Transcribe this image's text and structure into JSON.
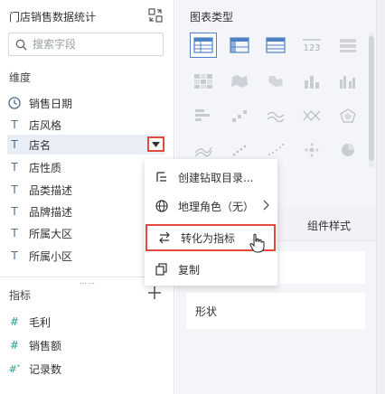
{
  "left": {
    "title": "门店销售数据统计",
    "search_placeholder": "搜索字段",
    "dimension_label": "维度",
    "dimensions": [
      {
        "label": "销售日期",
        "icon": "clock-icon"
      },
      {
        "label": "店风格",
        "icon": "text-type-icon"
      },
      {
        "label": "店名",
        "icon": "text-type-icon"
      },
      {
        "label": "店性质",
        "icon": "text-type-icon"
      },
      {
        "label": "品类描述",
        "icon": "text-type-icon"
      },
      {
        "label": "品牌描述",
        "icon": "text-type-icon"
      },
      {
        "label": "所属大区",
        "icon": "text-type-icon"
      },
      {
        "label": "所属小区",
        "icon": "text-type-icon"
      }
    ],
    "metric_label": "指标",
    "metrics": [
      {
        "label": "毛利",
        "icon": "hash-icon"
      },
      {
        "label": "销售额",
        "icon": "hash-icon"
      },
      {
        "label": "记录数",
        "icon": "hash-star-icon"
      }
    ],
    "dimension_type_glyph": "T",
    "metric_type_glyph": "#"
  },
  "mid": {
    "title": "图表类型",
    "tab_style": "组件样式",
    "shape_label": "形状"
  },
  "menu": {
    "items": [
      {
        "label": "创建钻取目录...",
        "icon": "drill-icon"
      },
      {
        "label": "地理角色（无）",
        "icon": "globe-icon"
      },
      {
        "label": "转化为指标",
        "icon": "swap-icon"
      },
      {
        "label": "复制",
        "icon": "copy-icon"
      }
    ]
  },
  "colors": {
    "accent": "#4f82c4",
    "highlight_border": "#e04a3f",
    "panel_bg": "#f3f5f8"
  }
}
